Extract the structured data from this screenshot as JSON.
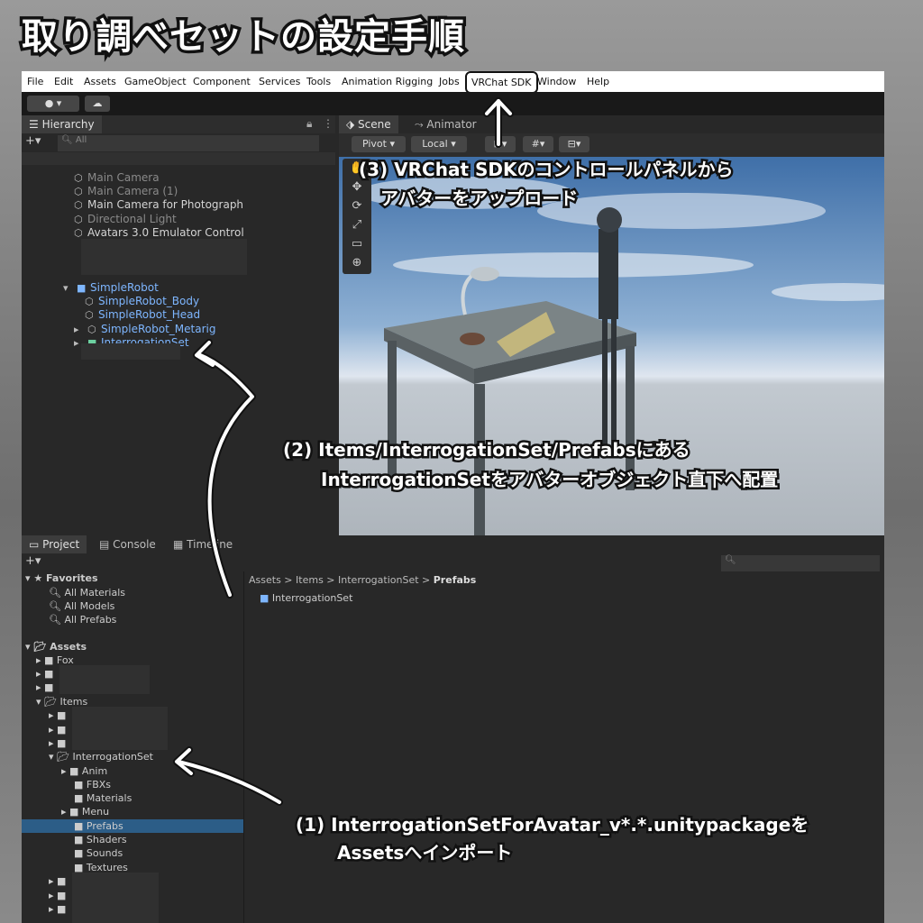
{
  "title": "取り調べセットの設定手順",
  "menu": [
    "File",
    "Edit",
    "Assets",
    "GameObject",
    "Component",
    "Services",
    "Tools",
    "Animation Rigging",
    "Jobs",
    "VRChat SDK",
    "Window",
    "Help"
  ],
  "hierarchy": {
    "tab": "Hierarchy",
    "search_placeholder": "All",
    "items": [
      {
        "label": "Main Camera",
        "style": "dim"
      },
      {
        "label": "Main Camera (1)",
        "style": "dim"
      },
      {
        "label": "Main Camera for Photograph",
        "style": "lite"
      },
      {
        "label": "Directional Light",
        "style": "dim"
      },
      {
        "label": "Avatars 3.0 Emulator Control",
        "style": "lite"
      },
      {
        "label": "SimpleRobot",
        "style": "blue"
      },
      {
        "label": "SimpleRobot_Body",
        "style": "blue"
      },
      {
        "label": "SimpleRobot_Head",
        "style": "blue"
      },
      {
        "label": "SimpleRobot_Metarig",
        "style": "blue"
      },
      {
        "label": "InterrogationSet",
        "style": "blue"
      }
    ]
  },
  "scene": {
    "tabs": [
      "Scene",
      "Animator"
    ],
    "pivot": "Pivot",
    "local": "Local"
  },
  "project": {
    "tabs": [
      "Project",
      "Console",
      "Timeline"
    ],
    "breadcrumb": [
      "Assets",
      "Items",
      "InterrogationSet",
      "Prefabs"
    ],
    "asset": "InterrogationSet",
    "favorites_label": "Favorites",
    "favorites": [
      "All Materials",
      "All Models",
      "All Prefabs"
    ],
    "assets_label": "Assets",
    "fox": "Fox",
    "items": "Items",
    "interrogation": "InterrogationSet",
    "subfolders": [
      "Anim",
      "FBXs",
      "Materials",
      "Menu",
      "Prefabs",
      "Shaders",
      "Sounds",
      "Textures"
    ]
  },
  "annotations": {
    "step1_a": "(1) InterrogationSetForAvatar_v*.*.unitypackageを",
    "step1_b": "Assetsへインポート",
    "step2_a": "(2) Items/InterrogationSet/Prefabsにある",
    "step2_b": "InterrogationSetをアバターオブジェクト直下へ配置",
    "step3_a": "(3) VRChat SDKのコントロールパネルから",
    "step3_b": "アバターをアップロード"
  }
}
